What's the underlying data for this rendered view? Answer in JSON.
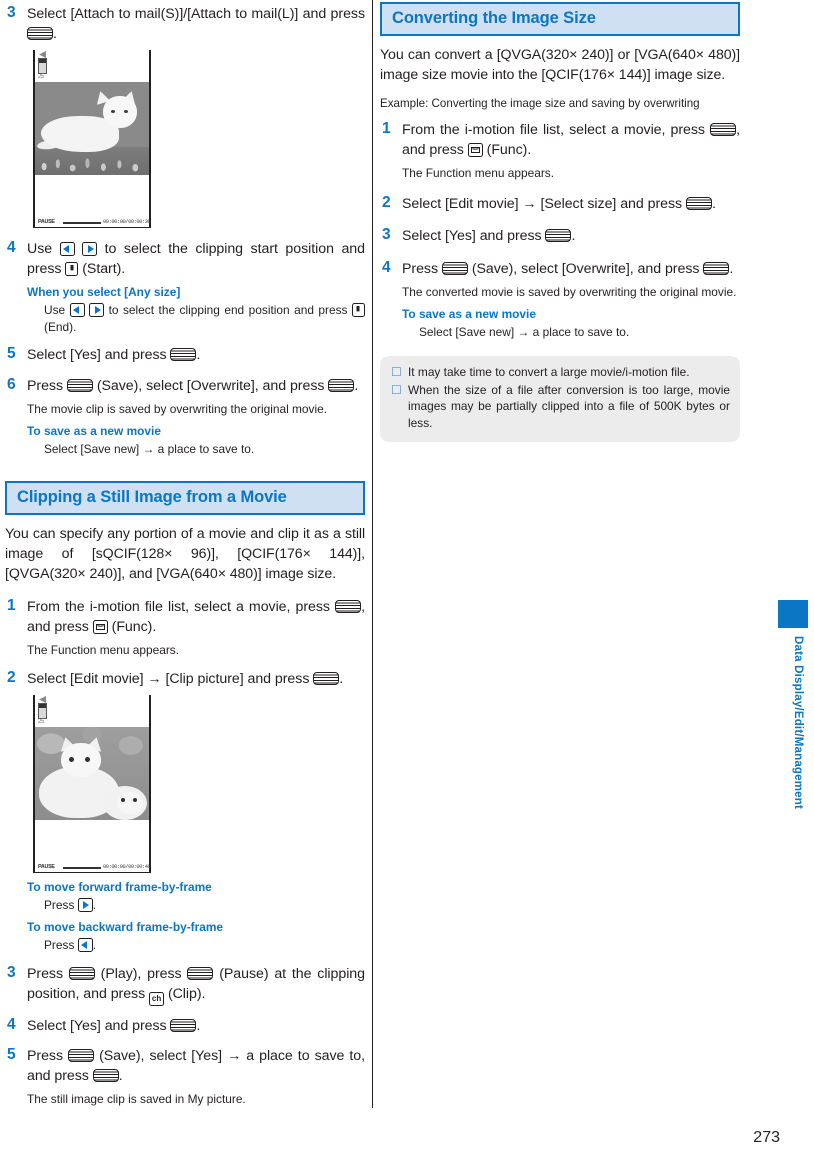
{
  "page": {
    "number": "273",
    "side_tab_label": "Data Display/Edit/Management",
    "accent_blue": "#0b76c4",
    "header_bg": "#cfe0f2",
    "tip_bg": "#ececec"
  },
  "left_column": {
    "continued_steps": [
      {
        "num": "3",
        "text_parts": [
          "Select [Attach to mail(S)]/[Attach to mail(L)] and press ",
          "",
          "."
        ],
        "icons": [
          "select-key"
        ]
      }
    ],
    "step3": {
      "num": "3",
      "pre": "Select [Attach to mail(S)]/[Attach to mail(L)] and press ",
      "post": "."
    },
    "phone_screen_1": {
      "battery_label": "25",
      "status_label": "PAUSE",
      "timecode": "00:00:00/00:00:30",
      "caption": "movie-player-kitten"
    },
    "step4": {
      "num": "4",
      "pre": "Use ",
      "mid": " to select the clipping start position and press ",
      "post": " (Start)."
    },
    "step4_sub": {
      "heading": "When you select [Any size]",
      "pre": "Use ",
      "mid": " to select the clipping end position and press ",
      "post": " (End)."
    },
    "step5": {
      "num": "5",
      "pre": "Select [Yes] and press ",
      "post": "."
    },
    "step6": {
      "num": "6",
      "pre": "Press ",
      "mid": " (Save), select [Overwrite], and press ",
      "post": ".",
      "note": "The movie clip is saved by overwriting the original movie.",
      "sub_heading": "To save as a new movie",
      "sub_body": "Select [Save new] → a place to save to."
    },
    "section": {
      "title": "Clipping a Still Image from a Movie",
      "lead": "You can specify any portion of a movie and clip it as a still image of [sQCIF(128× 96)], [QCIF(176× 144)], [QVGA(320× 240)], and [VGA(640× 480)] image size."
    },
    "c_step1": {
      "num": "1",
      "pre": "From the i-motion file list, select a movie, press ",
      "mid": ", and press ",
      "post": " (Func).",
      "note": "The Function menu appears."
    },
    "c_step2": {
      "num": "2",
      "pre": "Select [Edit movie] → [Clip picture] and press ",
      "post": "."
    },
    "phone_screen_2": {
      "battery_label": "25",
      "status_label": "PAUSE",
      "timecode": "00:00:00/00:00:40",
      "caption": "movie-player-two-kittens"
    },
    "frame_fwd": {
      "heading": "To move forward frame-by-frame",
      "pre": "Press ",
      "post": "."
    },
    "frame_back": {
      "heading": "To move backward frame-by-frame",
      "pre": "Press ",
      "post": "."
    },
    "c_step3": {
      "num": "3",
      "pre": "Press ",
      "mid": " (Play), press ",
      "mid2": " (Pause) at the clipping position, and press ",
      "post": " (Clip)."
    },
    "c_step4": {
      "num": "4",
      "pre": "Select [Yes] and press ",
      "post": "."
    },
    "c_step5": {
      "num": "5",
      "pre": "Press ",
      "mid": " (Save), select [Yes] → a place to save to, and press ",
      "post": ".",
      "note": "The still image clip is saved in My picture."
    }
  },
  "right_column": {
    "section": {
      "title": "Converting the Image Size",
      "lead": "You can convert a [QVGA(320× 240)] or [VGA(640× 480)] image size movie into the [QCIF(176× 144)] image size.",
      "example": "Example: Converting the image size and saving by overwriting"
    },
    "step1": {
      "num": "1",
      "pre": "From the i-motion file list, select a movie, press ",
      "mid": ", and press ",
      "post": " (Func).",
      "note": "The Function menu appears."
    },
    "step2": {
      "num": "2",
      "pre": "Select [Edit movie] → [Select size] and press ",
      "post": "."
    },
    "step3": {
      "num": "3",
      "pre": "Select [Yes] and press ",
      "post": "."
    },
    "step4": {
      "num": "4",
      "pre": "Press ",
      "mid": " (Save), select [Overwrite], and press ",
      "post": ".",
      "note": "The converted movie is saved by overwriting the original movie.",
      "sub_heading": "To save as a new movie",
      "sub_body": "Select [Save new] → a place to save to."
    },
    "tips": [
      "It may take time to convert a large movie/i-motion file.",
      "When the size of a file after conversion is too large, movie images may be partially clipped into a file of 500K bytes or less."
    ]
  }
}
